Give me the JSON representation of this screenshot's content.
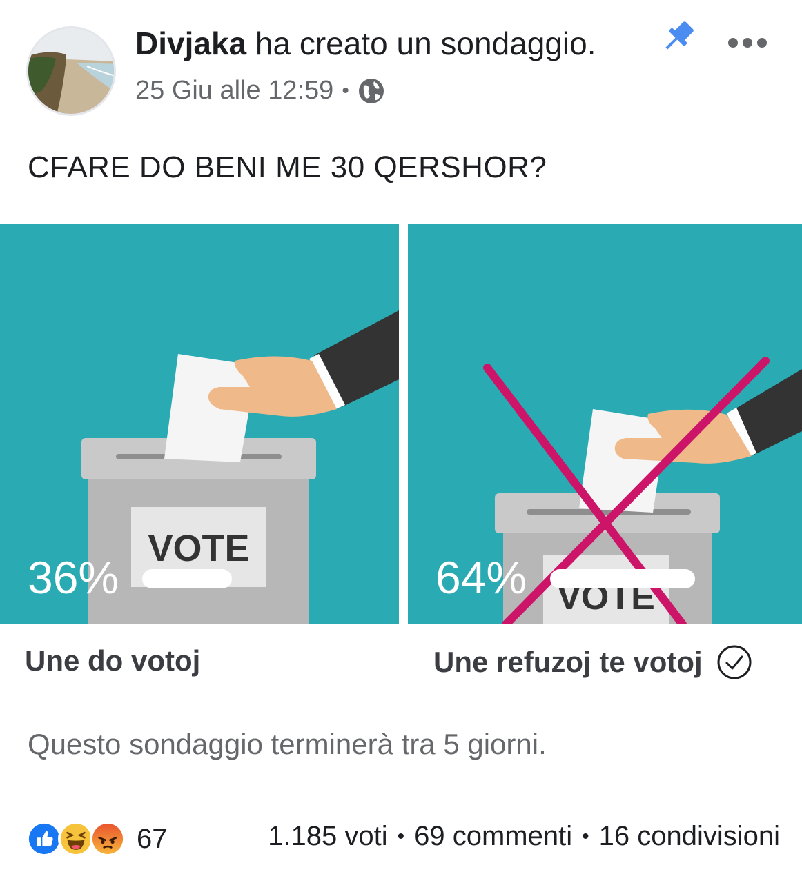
{
  "header": {
    "author": "Divjaka",
    "action": "ha creato un sondaggio.",
    "date": "25 Giu alle 12:59",
    "separator": "•"
  },
  "icons": {
    "pin": "pin-icon",
    "more": "more-options-icon",
    "audience": "globe-icon",
    "voted": "check-circle-icon"
  },
  "colors": {
    "poll_background": "#2aaab3",
    "cross_mark": "#cc1469",
    "pin_blue": "#4a8cf0"
  },
  "question": "CFARE DO BENI ME 30 QERSHOR?",
  "poll": {
    "options": [
      {
        "label": "Une do votoj",
        "percent_text": "36%",
        "percent": 36,
        "box_label": "VOTE",
        "selected": false
      },
      {
        "label": "Une refuzoj te votoj",
        "percent_text": "64%",
        "percent": 64,
        "box_label": "VOTE",
        "selected": true
      }
    ],
    "footer": "Questo sondaggio terminerà tra 5 giorni."
  },
  "engagement": {
    "reaction_types": [
      "like",
      "haha",
      "angry"
    ],
    "reaction_count": "67",
    "votes": "1.185 voti",
    "comments": "69 commenti",
    "shares": "16 condivisioni",
    "separator": "•"
  }
}
